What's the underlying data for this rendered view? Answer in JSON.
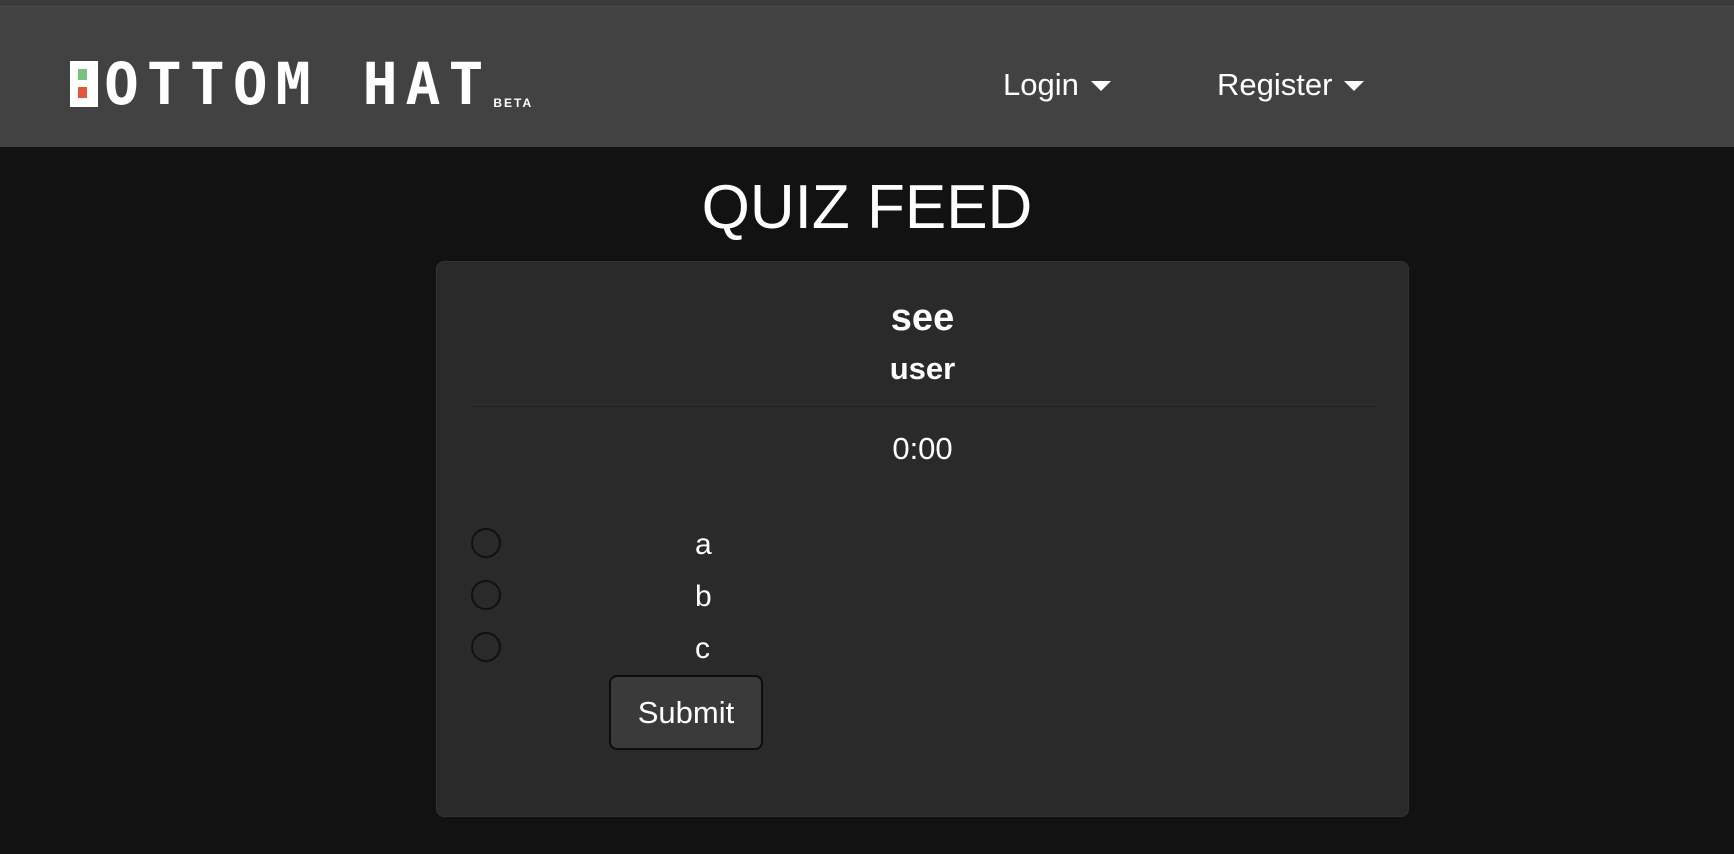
{
  "navbar": {
    "brand_word_1": "OTTOM",
    "brand_word_2": "HAT",
    "beta_label": "BETA",
    "login_label": "Login",
    "register_label": "Register"
  },
  "page": {
    "title": "QUIZ FEED"
  },
  "quiz": {
    "title": "see",
    "author": "user",
    "timer": "0:00",
    "options": [
      "a",
      "b",
      "c"
    ],
    "submit_label": "Submit"
  },
  "colors": {
    "background": "#121212",
    "navbar": "#424242",
    "card": "#2a2a2a",
    "logo_green": "#78c27f",
    "logo_red": "#e4553b"
  }
}
